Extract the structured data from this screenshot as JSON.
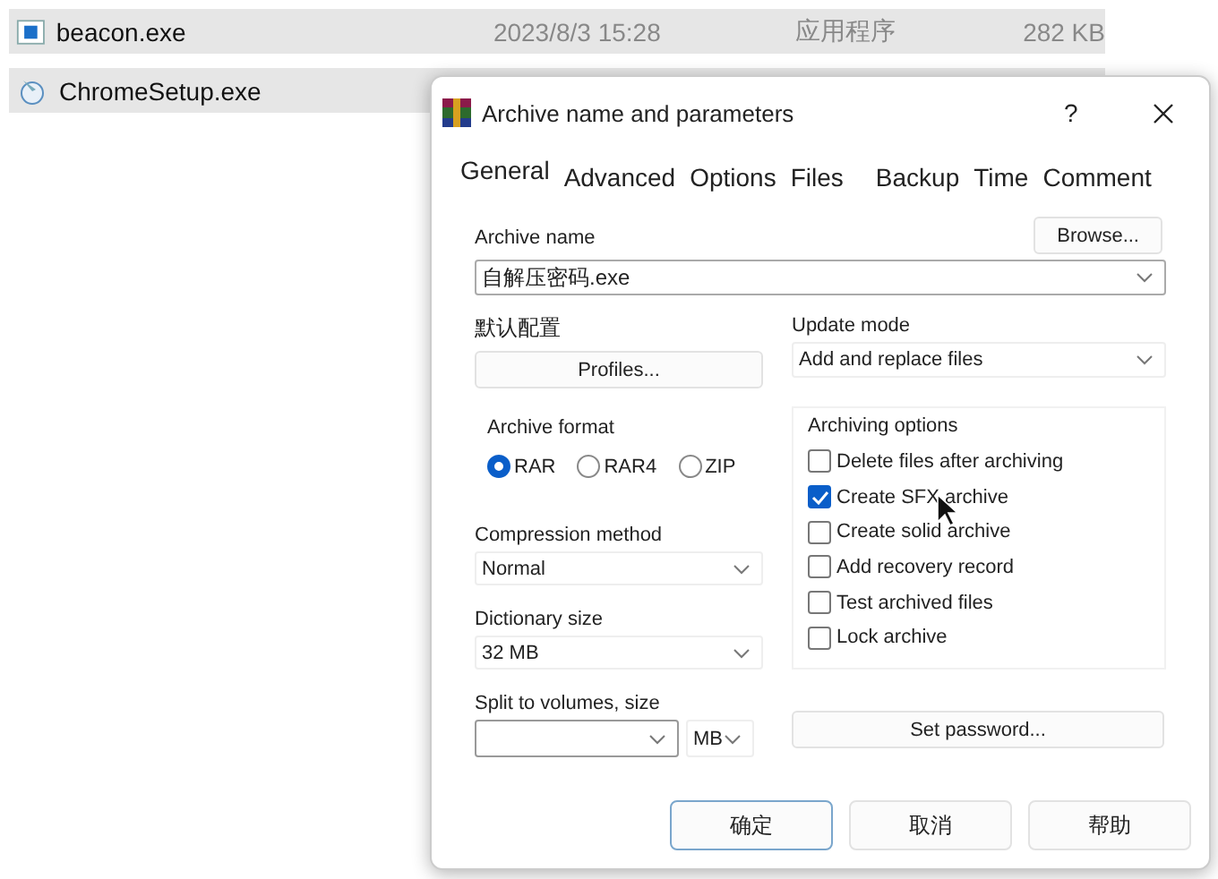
{
  "files": [
    {
      "name": "beacon.exe",
      "date": "2023/8/3 15:28",
      "type": "应用程序",
      "size": "282 KB",
      "kind": "app"
    },
    {
      "name": "ChromeSetup.exe",
      "kind": "setup"
    }
  ],
  "dialog": {
    "title": "Archive name and parameters",
    "help": "?",
    "tabs": [
      {
        "label": "General",
        "selected": true
      },
      {
        "label": "Advanced",
        "selected": false
      },
      {
        "label": "Options",
        "selected": false
      },
      {
        "label": "Files",
        "selected": false
      },
      {
        "label": "Backup",
        "selected": false
      },
      {
        "label": "Time",
        "selected": false
      },
      {
        "label": "Comment",
        "selected": false
      }
    ],
    "archive_name": {
      "label": "Archive name",
      "value": "自解压密码.exe",
      "browse": "Browse..."
    },
    "profiles": {
      "label": "默认配置",
      "button": "Profiles..."
    },
    "update_mode": {
      "label": "Update mode",
      "value": "Add and replace files"
    },
    "archive_format": {
      "label": "Archive format",
      "options": [
        {
          "label": "RAR",
          "selected": true
        },
        {
          "label": "RAR4",
          "selected": false
        },
        {
          "label": "ZIP",
          "selected": false
        }
      ]
    },
    "compression_method": {
      "label": "Compression method",
      "value": "Normal"
    },
    "dictionary_size": {
      "label": "Dictionary size",
      "value": "32 MB"
    },
    "split": {
      "label": "Split to volumes, size",
      "unit": "MB"
    },
    "archiving_options": {
      "label": "Archiving options",
      "options": [
        {
          "label": "Delete files after archiving",
          "checked": false
        },
        {
          "label": "Create SFX archive",
          "checked": true
        },
        {
          "label": "Create solid archive",
          "checked": false
        },
        {
          "label": "Add recovery record",
          "checked": false
        },
        {
          "label": "Test archived files",
          "checked": false
        },
        {
          "label": "Lock archive",
          "checked": false
        }
      ]
    },
    "set_password": "Set password...",
    "buttons": [
      {
        "label": "确定",
        "default": true
      },
      {
        "label": "取消",
        "default": false
      },
      {
        "label": "帮助",
        "default": false
      }
    ]
  }
}
